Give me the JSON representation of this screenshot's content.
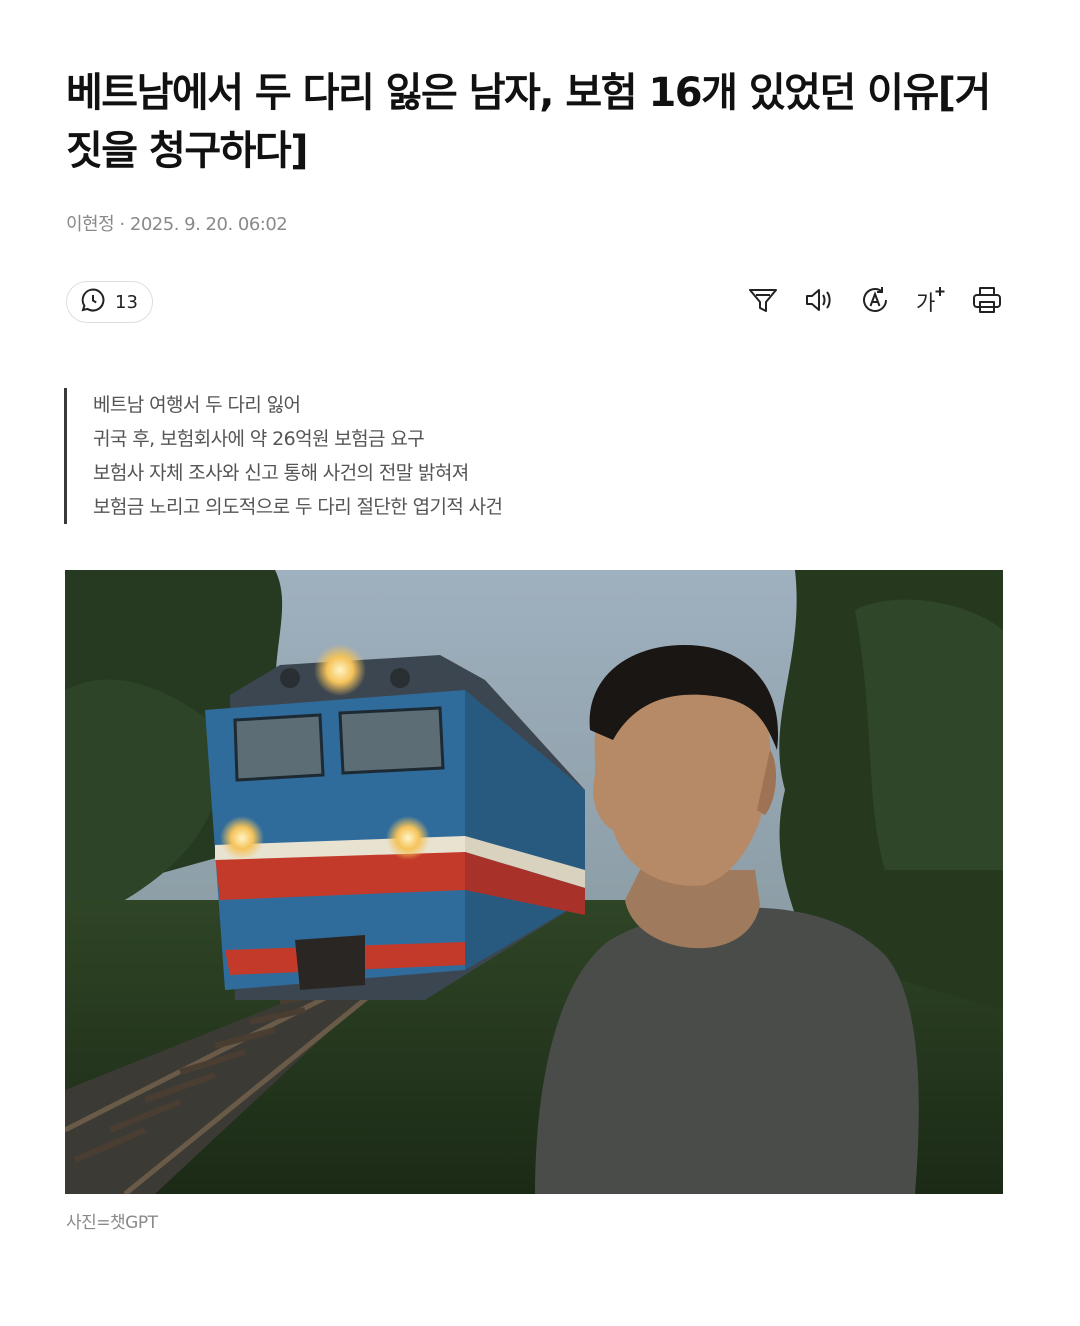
{
  "article": {
    "headline": "베트남에서 두 다리 잃은 남자, 보험 16개 있었던 이유[거짓을 청구하다]",
    "author": "이현정",
    "separator": "·",
    "datetime": "2025. 9. 20. 06:02"
  },
  "toolbar": {
    "comment_count": "13",
    "tools": [
      "summary-funnel-icon",
      "speaker-icon",
      "translate-icon",
      "font-size-icon",
      "print-icon"
    ],
    "font_size_label": "가"
  },
  "summary": {
    "lines": [
      "베트남 여행서 두 다리 잃어",
      "귀국 후, 보험회사에 약 26억원 보험금 요구",
      "보험사 자체 조사와 신고 통해 사건의 전말 밝혀져",
      "보험금 노리고 의도적으로 두 다리 절단한 엽기적 사건"
    ]
  },
  "photo": {
    "caption": "사진=챗GPT",
    "subject": "man in grey t-shirt beside blue and red locomotive on railway tracks at dusk"
  },
  "colors": {
    "text": "#111111",
    "meta": "#8a8a8a",
    "summary_text": "#555555",
    "summary_bar": "#3a3a3a"
  }
}
